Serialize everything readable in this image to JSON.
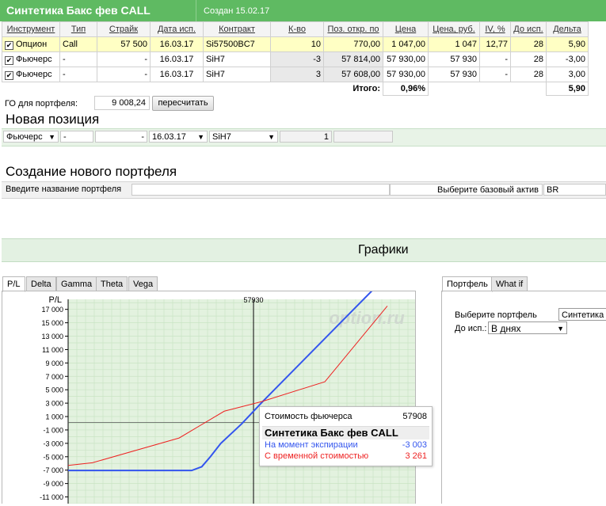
{
  "header": {
    "title": "Синтетика Бакс фев CALL",
    "created": "Создан 15.02.17"
  },
  "table": {
    "columns": [
      "Инструмент",
      "Тип",
      "Страйк",
      "Дата исп.",
      "Контракт",
      "К-во",
      "Поз. откр. по",
      "Цена",
      "Цена, руб.",
      "IV, %",
      "До исп.",
      "Дельта"
    ],
    "rows": [
      {
        "instrument": "Опцион",
        "type": "Call",
        "strike": "57 500",
        "date": "16.03.17",
        "contract": "Si57500BC7",
        "qty": "10",
        "open": "770,00",
        "price": "1 047,00",
        "price_rub": "1 047",
        "iv": "12,77",
        "days": "28",
        "delta": "5,90"
      },
      {
        "instrument": "Фьючерс",
        "type": "-",
        "strike": "-",
        "date": "16.03.17",
        "contract": "SiH7",
        "qty": "-3",
        "open": "57 814,00",
        "price": "57 930,00",
        "price_rub": "57 930",
        "iv": "-",
        "days": "28",
        "delta": "-3,00"
      },
      {
        "instrument": "Фьючерс",
        "type": "-",
        "strike": "-",
        "date": "16.03.17",
        "contract": "SiH7",
        "qty": "3",
        "open": "57 608,00",
        "price": "57 930,00",
        "price_rub": "57 930",
        "iv": "-",
        "days": "28",
        "delta": "3,00"
      }
    ],
    "total_label": "Итого:",
    "total_pct": "0,96%",
    "total_delta": "5,90"
  },
  "go": {
    "label": "ГО для портфеля:",
    "value": "9 008,24",
    "button": "пересчитать"
  },
  "new_position": {
    "title": "Новая позиция",
    "instrument": "Фьючерс",
    "type": "-",
    "strike": "-",
    "date": "16.03.17",
    "contract": "SiH7",
    "qty": "1"
  },
  "new_portfolio": {
    "title": "Создание нового портфеля",
    "name_label": "Введите название портфеля",
    "asset_label": "Выберите базовый актив",
    "asset_value": "BR"
  },
  "graphics": {
    "title": "Графики",
    "tabs": [
      "P/L",
      "Delta",
      "Gamma",
      "Theta",
      "Vega"
    ],
    "right_tabs": [
      "Портфель",
      "What if"
    ],
    "select_portfolio_label": "Выберите портфель",
    "select_portfolio_value": "Синтетика",
    "expiry_label": "До исп.:",
    "expiry_value": "В днях"
  },
  "chart_data": {
    "type": "line",
    "ylabel": "P/L",
    "xmarker": "57930",
    "y_ticks": [
      "17 000",
      "15 000",
      "13 000",
      "11 000",
      "9 000",
      "7 000",
      "5 000",
      "3 000",
      "1 000",
      "-1 000",
      "-3 000",
      "-5 000",
      "-7 000",
      "-9 000",
      "-11 000"
    ],
    "watermark": "option.ru",
    "ylim": [
      -12000,
      18500
    ],
    "series": [
      {
        "name": "На момент экспирации",
        "color": "#3355ee",
        "x": [
          0,
          0.356,
          0.385,
          0.41,
          0.44,
          0.5,
          0.56,
          0.88
        ],
        "y": [
          -7050,
          -7050,
          -6500,
          -5000,
          -3003,
          -100,
          3200,
          20000
        ]
      },
      {
        "name": "С временной стоимостью",
        "color": "#ee2222",
        "x": [
          0,
          0.07,
          0.32,
          0.45,
          0.56,
          0.74,
          0.92
        ],
        "y": [
          -6300,
          -5900,
          -2200,
          1800,
          3261,
          6200,
          17500
        ]
      }
    ]
  },
  "tooltip": {
    "label": "Стоимость фьючерса",
    "value": "57908",
    "title": "Синтетика Бакс фев CALL",
    "exp_label": "На момент экспирации",
    "exp_value": "-3 003",
    "time_label": "С временной стоимостью",
    "time_value": "3 261",
    "exp_color": "#3355ee",
    "time_color": "#ee2222"
  }
}
